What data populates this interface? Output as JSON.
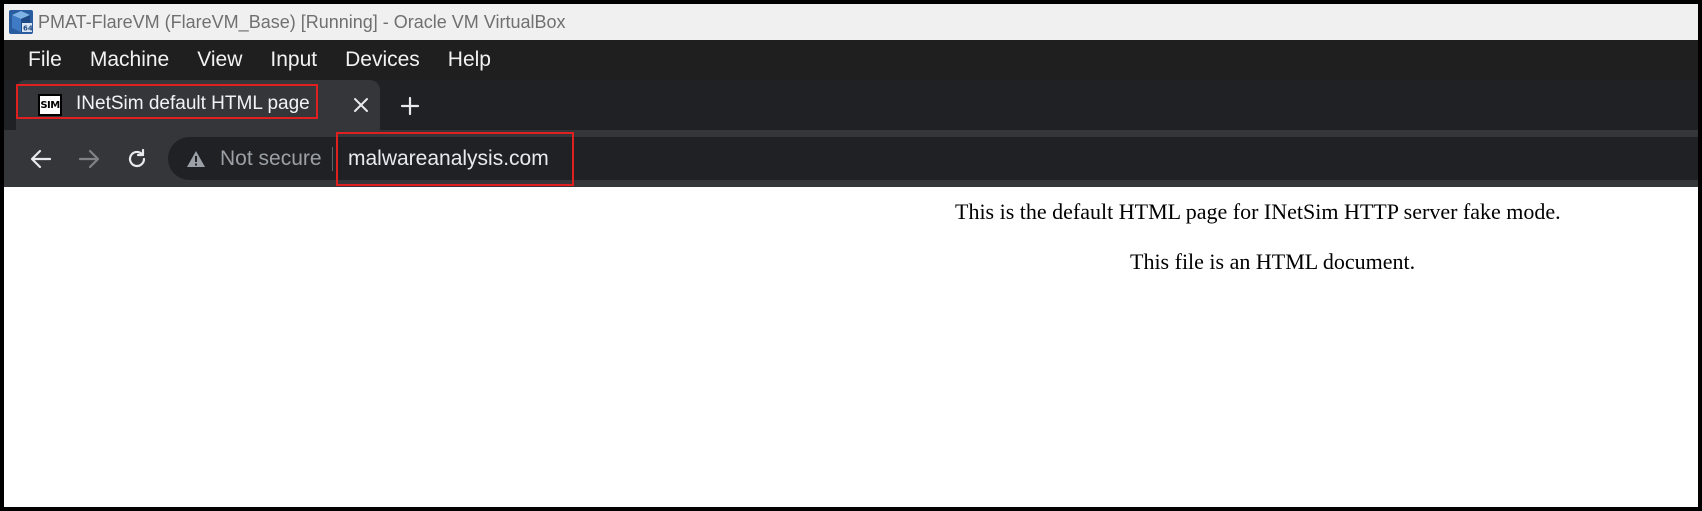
{
  "window": {
    "title": "PMAT-FlareVM (FlareVM_Base) [Running] - Oracle VM VirtualBox"
  },
  "menubar": {
    "items": [
      {
        "label": "File"
      },
      {
        "label": "Machine"
      },
      {
        "label": "View"
      },
      {
        "label": "Input"
      },
      {
        "label": "Devices"
      },
      {
        "label": "Help"
      }
    ]
  },
  "browser": {
    "tab": {
      "favicon_text": "SIM",
      "title": "INetSim default HTML page"
    },
    "toolbar": {
      "security_label": "Not secure",
      "url": "malwareanalysis.com"
    }
  },
  "page": {
    "paragraphs": [
      "This is the default HTML page for INetSim HTTP server fake mode.",
      "This file is an HTML document."
    ]
  },
  "colors": {
    "highlight_box": "#e02020",
    "menubar_bg": "#1f1f1f",
    "tabstrip_bg": "#202124",
    "toolbar_bg": "#35363a"
  }
}
